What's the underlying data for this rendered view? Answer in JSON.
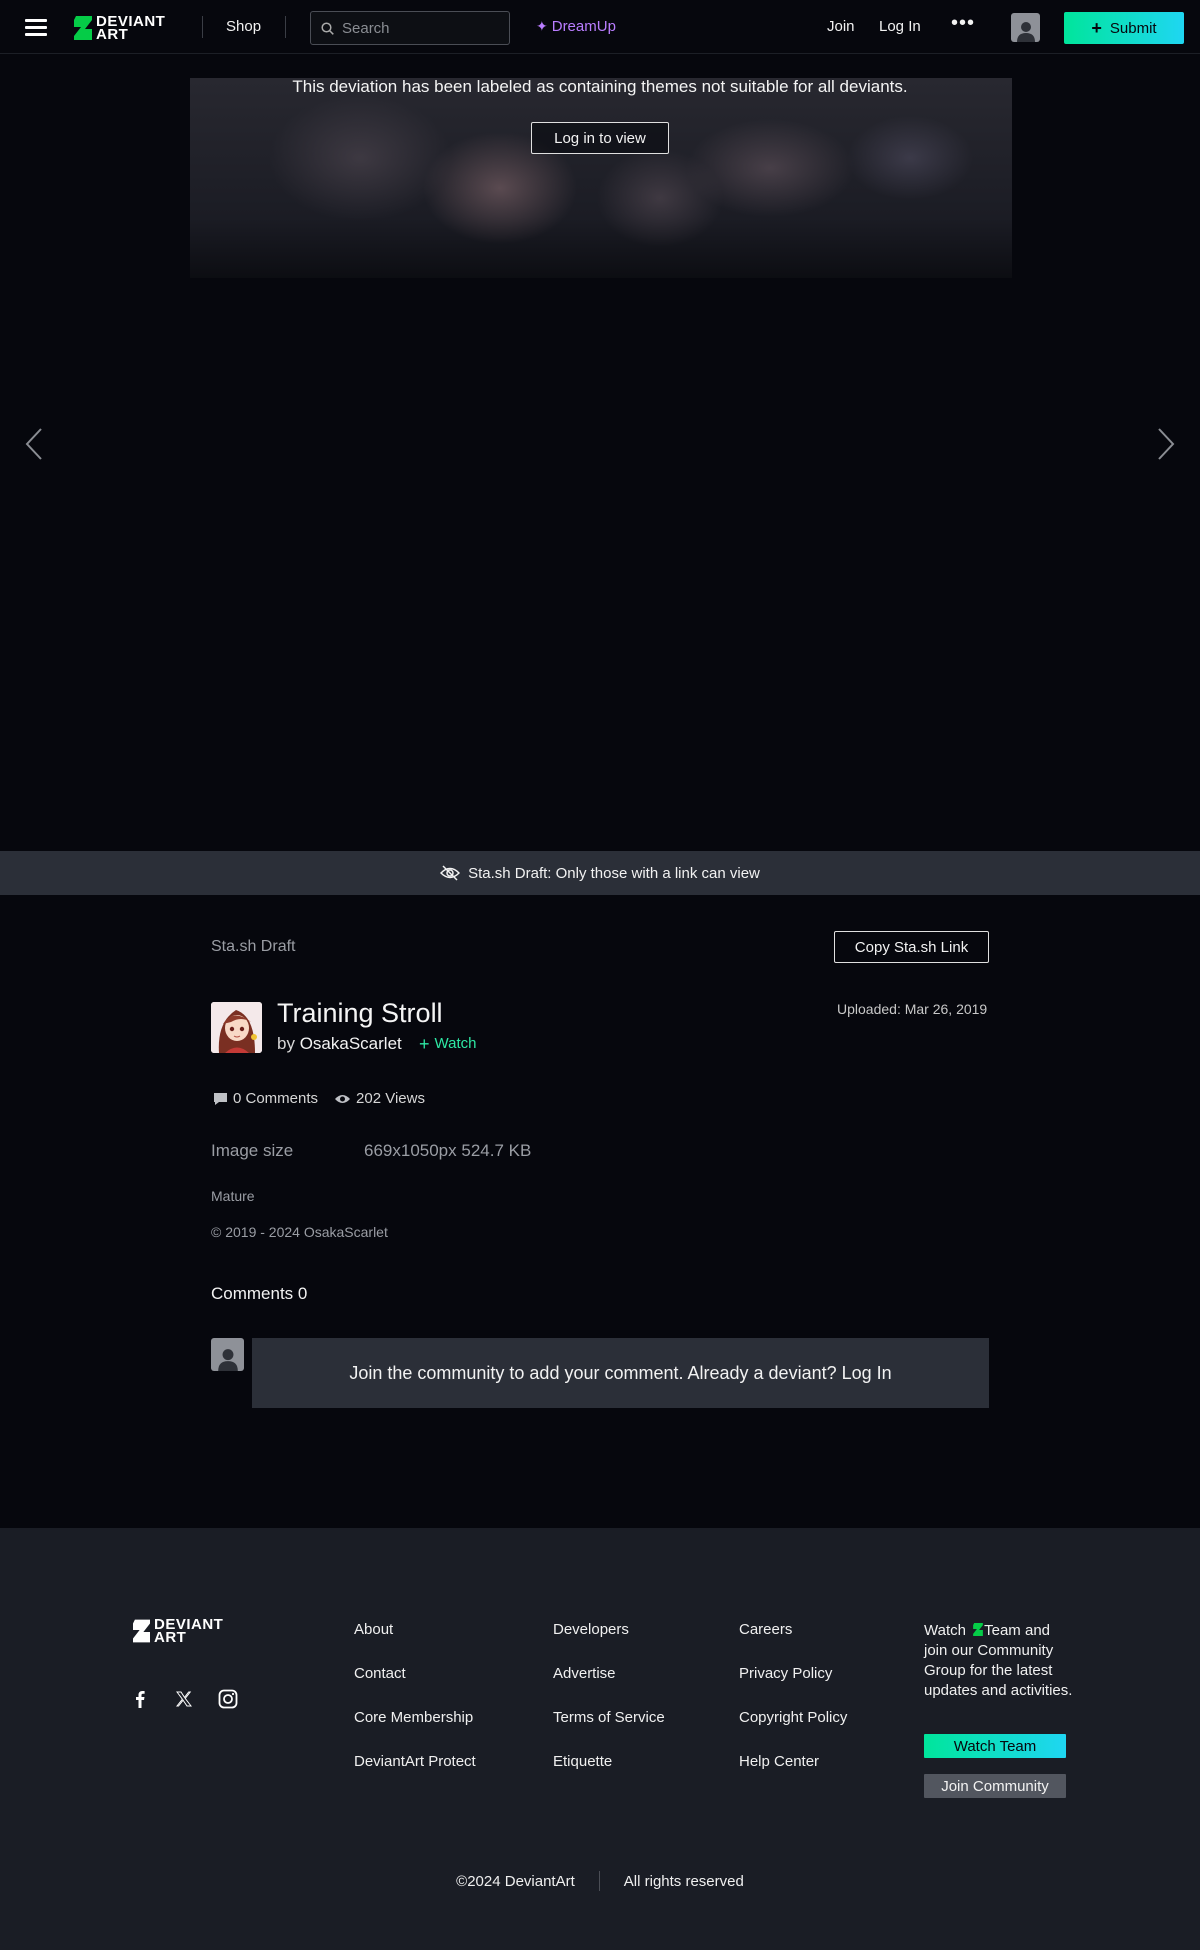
{
  "header": {
    "logo_top": "DEVIANT",
    "logo_bottom": "ART",
    "shop": "Shop",
    "search_placeholder": "Search",
    "dreamup": "DreamUp",
    "join": "Join",
    "login": "Log In",
    "more": "•••",
    "submit": "Submit"
  },
  "deviation": {
    "mature_message": "This deviation has been labeled as containing themes not suitable for all deviants.",
    "login_to_view": "Log in to view"
  },
  "stash_banner": "Sta.sh Draft: Only those with a link can view",
  "details": {
    "stash_label": "Sta.sh Draft",
    "copy_link": "Copy Sta.sh Link",
    "title": "Training Stroll",
    "by": "by",
    "author": "OsakaScarlet",
    "watch": "Watch",
    "uploaded": "Uploaded: Mar 26, 2019",
    "comments_count": "0 Comments",
    "views": "202 Views",
    "image_size_label": "Image size",
    "image_size_value": "669x1050px 524.7 KB",
    "mature": "Mature",
    "copyright": "© 2019 - 2024 OsakaScarlet"
  },
  "comments": {
    "heading": "Comments 0",
    "prompt": "Join the community to add your comment. Already a deviant? Log In"
  },
  "footer": {
    "logo_top": "DEVIANT",
    "logo_bottom": "ART",
    "col1": [
      "About",
      "Contact",
      "Core Membership",
      "DeviantArt Protect"
    ],
    "col2": [
      "Developers",
      "Advertise",
      "Terms of Service",
      "Etiquette"
    ],
    "col3": [
      "Careers",
      "Privacy Policy",
      "Copyright Policy",
      "Help Center"
    ],
    "watch_pre": "Watch",
    "watch_post": "Team and join our Community Group for the latest updates and activities.",
    "watch_team": "Watch Team",
    "join_community": "Join Community",
    "copyright": "©2024 DeviantArt",
    "rights": "All rights reserved"
  },
  "colors": {
    "accent_green": "#00e59b",
    "accent_cyan": "#1fd6f2",
    "dreamup_purple": "#b97dff",
    "background": "#06070d"
  }
}
